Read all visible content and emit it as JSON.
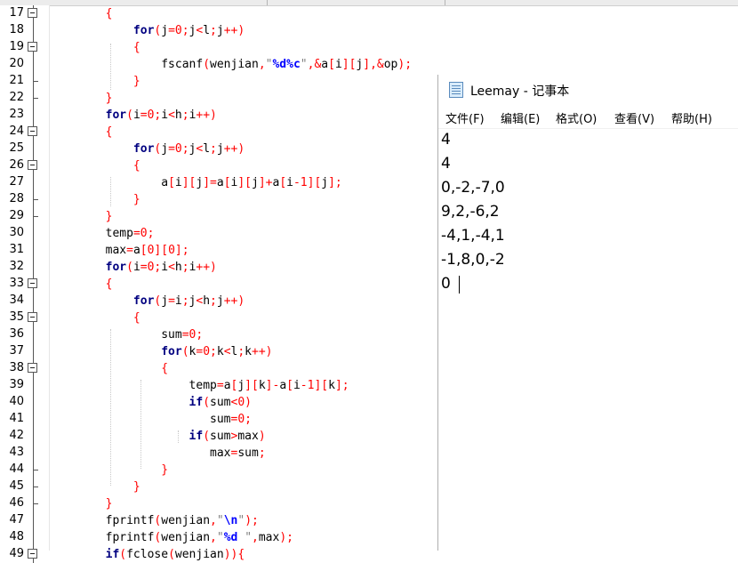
{
  "editor": {
    "lines": [
      {
        "n": "17",
        "fold": "box",
        "tokens": [
          {
            "t": "        {",
            "c": "op"
          }
        ]
      },
      {
        "n": "18",
        "fold": "line",
        "tokens": [
          {
            "t": "            ",
            "c": "id"
          },
          {
            "t": "for",
            "c": "kw"
          },
          {
            "t": "(",
            "c": "op"
          },
          {
            "t": "j",
            "c": "id"
          },
          {
            "t": "=",
            "c": "op"
          },
          {
            "t": "0",
            "c": "num"
          },
          {
            "t": ";",
            "c": "op"
          },
          {
            "t": "j",
            "c": "id"
          },
          {
            "t": "<",
            "c": "op"
          },
          {
            "t": "l",
            "c": "id"
          },
          {
            "t": ";",
            "c": "op"
          },
          {
            "t": "j",
            "c": "id"
          },
          {
            "t": "++)",
            "c": "op"
          }
        ]
      },
      {
        "n": "19",
        "fold": "box",
        "tokens": [
          {
            "t": "            {",
            "c": "op"
          }
        ]
      },
      {
        "n": "20",
        "fold": "line",
        "tokens": [
          {
            "t": "                ",
            "c": "id"
          },
          {
            "t": "fscanf",
            "c": "id"
          },
          {
            "t": "(",
            "c": "op"
          },
          {
            "t": "wenjian",
            "c": "id"
          },
          {
            "t": ",",
            "c": "op"
          },
          {
            "t": "\"",
            "c": "str"
          },
          {
            "t": "%d%c",
            "c": "fs"
          },
          {
            "t": "\"",
            "c": "str"
          },
          {
            "t": ",&",
            "c": "op"
          },
          {
            "t": "a",
            "c": "id"
          },
          {
            "t": "[",
            "c": "op"
          },
          {
            "t": "i",
            "c": "id"
          },
          {
            "t": "][",
            "c": "op"
          },
          {
            "t": "j",
            "c": "id"
          },
          {
            "t": "],&",
            "c": "op"
          },
          {
            "t": "op",
            "c": "id"
          },
          {
            "t": ");",
            "c": "op"
          }
        ]
      },
      {
        "n": "21",
        "fold": "tick",
        "tokens": [
          {
            "t": "            }",
            "c": "op"
          }
        ]
      },
      {
        "n": "22",
        "fold": "tick",
        "tokens": [
          {
            "t": "        }",
            "c": "op"
          }
        ]
      },
      {
        "n": "23",
        "fold": "line",
        "tokens": [
          {
            "t": "        ",
            "c": "id"
          },
          {
            "t": "for",
            "c": "kw"
          },
          {
            "t": "(",
            "c": "op"
          },
          {
            "t": "i",
            "c": "id"
          },
          {
            "t": "=",
            "c": "op"
          },
          {
            "t": "0",
            "c": "num"
          },
          {
            "t": ";",
            "c": "op"
          },
          {
            "t": "i",
            "c": "id"
          },
          {
            "t": "<",
            "c": "op"
          },
          {
            "t": "h",
            "c": "id"
          },
          {
            "t": ";",
            "c": "op"
          },
          {
            "t": "i",
            "c": "id"
          },
          {
            "t": "++)",
            "c": "op"
          }
        ]
      },
      {
        "n": "24",
        "fold": "box",
        "tokens": [
          {
            "t": "        {",
            "c": "op"
          }
        ]
      },
      {
        "n": "25",
        "fold": "line",
        "tokens": [
          {
            "t": "            ",
            "c": "id"
          },
          {
            "t": "for",
            "c": "kw"
          },
          {
            "t": "(",
            "c": "op"
          },
          {
            "t": "j",
            "c": "id"
          },
          {
            "t": "=",
            "c": "op"
          },
          {
            "t": "0",
            "c": "num"
          },
          {
            "t": ";",
            "c": "op"
          },
          {
            "t": "j",
            "c": "id"
          },
          {
            "t": "<",
            "c": "op"
          },
          {
            "t": "l",
            "c": "id"
          },
          {
            "t": ";",
            "c": "op"
          },
          {
            "t": "j",
            "c": "id"
          },
          {
            "t": "++)",
            "c": "op"
          }
        ]
      },
      {
        "n": "26",
        "fold": "box",
        "tokens": [
          {
            "t": "            {",
            "c": "op"
          }
        ]
      },
      {
        "n": "27",
        "fold": "line",
        "tokens": [
          {
            "t": "                ",
            "c": "id"
          },
          {
            "t": "a",
            "c": "id"
          },
          {
            "t": "[",
            "c": "op"
          },
          {
            "t": "i",
            "c": "id"
          },
          {
            "t": "][",
            "c": "op"
          },
          {
            "t": "j",
            "c": "id"
          },
          {
            "t": "]=",
            "c": "op"
          },
          {
            "t": "a",
            "c": "id"
          },
          {
            "t": "[",
            "c": "op"
          },
          {
            "t": "i",
            "c": "id"
          },
          {
            "t": "][",
            "c": "op"
          },
          {
            "t": "j",
            "c": "id"
          },
          {
            "t": "]+",
            "c": "op"
          },
          {
            "t": "a",
            "c": "id"
          },
          {
            "t": "[",
            "c": "op"
          },
          {
            "t": "i",
            "c": "id"
          },
          {
            "t": "-",
            "c": "op"
          },
          {
            "t": "1",
            "c": "num"
          },
          {
            "t": "][",
            "c": "op"
          },
          {
            "t": "j",
            "c": "id"
          },
          {
            "t": "];",
            "c": "op"
          }
        ]
      },
      {
        "n": "28",
        "fold": "tick",
        "tokens": [
          {
            "t": "            }",
            "c": "op"
          }
        ]
      },
      {
        "n": "29",
        "fold": "tick",
        "tokens": [
          {
            "t": "        }",
            "c": "op"
          }
        ]
      },
      {
        "n": "30",
        "fold": "line",
        "tokens": [
          {
            "t": "        ",
            "c": "id"
          },
          {
            "t": "temp",
            "c": "id"
          },
          {
            "t": "=",
            "c": "op"
          },
          {
            "t": "0",
            "c": "num"
          },
          {
            "t": ";",
            "c": "op"
          }
        ]
      },
      {
        "n": "31",
        "fold": "line",
        "tokens": [
          {
            "t": "        ",
            "c": "id"
          },
          {
            "t": "max",
            "c": "id"
          },
          {
            "t": "=",
            "c": "op"
          },
          {
            "t": "a",
            "c": "id"
          },
          {
            "t": "[",
            "c": "op"
          },
          {
            "t": "0",
            "c": "num"
          },
          {
            "t": "][",
            "c": "op"
          },
          {
            "t": "0",
            "c": "num"
          },
          {
            "t": "];",
            "c": "op"
          }
        ]
      },
      {
        "n": "32",
        "fold": "line",
        "tokens": [
          {
            "t": "        ",
            "c": "id"
          },
          {
            "t": "for",
            "c": "kw"
          },
          {
            "t": "(",
            "c": "op"
          },
          {
            "t": "i",
            "c": "id"
          },
          {
            "t": "=",
            "c": "op"
          },
          {
            "t": "0",
            "c": "num"
          },
          {
            "t": ";",
            "c": "op"
          },
          {
            "t": "i",
            "c": "id"
          },
          {
            "t": "<",
            "c": "op"
          },
          {
            "t": "h",
            "c": "id"
          },
          {
            "t": ";",
            "c": "op"
          },
          {
            "t": "i",
            "c": "id"
          },
          {
            "t": "++)",
            "c": "op"
          }
        ]
      },
      {
        "n": "33",
        "fold": "box",
        "tokens": [
          {
            "t": "        {",
            "c": "op"
          }
        ]
      },
      {
        "n": "34",
        "fold": "line",
        "tokens": [
          {
            "t": "            ",
            "c": "id"
          },
          {
            "t": "for",
            "c": "kw"
          },
          {
            "t": "(",
            "c": "op"
          },
          {
            "t": "j",
            "c": "id"
          },
          {
            "t": "=",
            "c": "op"
          },
          {
            "t": "i",
            "c": "id"
          },
          {
            "t": ";",
            "c": "op"
          },
          {
            "t": "j",
            "c": "id"
          },
          {
            "t": "<",
            "c": "op"
          },
          {
            "t": "h",
            "c": "id"
          },
          {
            "t": ";",
            "c": "op"
          },
          {
            "t": "j",
            "c": "id"
          },
          {
            "t": "++)",
            "c": "op"
          }
        ]
      },
      {
        "n": "35",
        "fold": "box",
        "tokens": [
          {
            "t": "            {",
            "c": "op"
          }
        ]
      },
      {
        "n": "36",
        "fold": "line",
        "tokens": [
          {
            "t": "                ",
            "c": "id"
          },
          {
            "t": "sum",
            "c": "id"
          },
          {
            "t": "=",
            "c": "op"
          },
          {
            "t": "0",
            "c": "num"
          },
          {
            "t": ";",
            "c": "op"
          }
        ]
      },
      {
        "n": "37",
        "fold": "line",
        "tokens": [
          {
            "t": "                ",
            "c": "id"
          },
          {
            "t": "for",
            "c": "kw"
          },
          {
            "t": "(",
            "c": "op"
          },
          {
            "t": "k",
            "c": "id"
          },
          {
            "t": "=",
            "c": "op"
          },
          {
            "t": "0",
            "c": "num"
          },
          {
            "t": ";",
            "c": "op"
          },
          {
            "t": "k",
            "c": "id"
          },
          {
            "t": "<",
            "c": "op"
          },
          {
            "t": "l",
            "c": "id"
          },
          {
            "t": ";",
            "c": "op"
          },
          {
            "t": "k",
            "c": "id"
          },
          {
            "t": "++)",
            "c": "op"
          }
        ]
      },
      {
        "n": "38",
        "fold": "box",
        "tokens": [
          {
            "t": "                {",
            "c": "op"
          }
        ]
      },
      {
        "n": "39",
        "fold": "line",
        "tokens": [
          {
            "t": "                    ",
            "c": "id"
          },
          {
            "t": "temp",
            "c": "id"
          },
          {
            "t": "=",
            "c": "op"
          },
          {
            "t": "a",
            "c": "id"
          },
          {
            "t": "[",
            "c": "op"
          },
          {
            "t": "j",
            "c": "id"
          },
          {
            "t": "][",
            "c": "op"
          },
          {
            "t": "k",
            "c": "id"
          },
          {
            "t": "]-",
            "c": "op"
          },
          {
            "t": "a",
            "c": "id"
          },
          {
            "t": "[",
            "c": "op"
          },
          {
            "t": "i",
            "c": "id"
          },
          {
            "t": "-",
            "c": "op"
          },
          {
            "t": "1",
            "c": "num"
          },
          {
            "t": "][",
            "c": "op"
          },
          {
            "t": "k",
            "c": "id"
          },
          {
            "t": "];",
            "c": "op"
          }
        ]
      },
      {
        "n": "40",
        "fold": "line",
        "tokens": [
          {
            "t": "                    ",
            "c": "id"
          },
          {
            "t": "if",
            "c": "kw"
          },
          {
            "t": "(",
            "c": "op"
          },
          {
            "t": "sum",
            "c": "id"
          },
          {
            "t": "<",
            "c": "op"
          },
          {
            "t": "0",
            "c": "num"
          },
          {
            "t": ")",
            "c": "op"
          }
        ]
      },
      {
        "n": "41",
        "fold": "line",
        "tokens": [
          {
            "t": "                       ",
            "c": "id"
          },
          {
            "t": "sum",
            "c": "id"
          },
          {
            "t": "=",
            "c": "op"
          },
          {
            "t": "0",
            "c": "num"
          },
          {
            "t": ";",
            "c": "op"
          }
        ]
      },
      {
        "n": "42",
        "fold": "line",
        "tokens": [
          {
            "t": "                    ",
            "c": "id"
          },
          {
            "t": "if",
            "c": "kw"
          },
          {
            "t": "(",
            "c": "op"
          },
          {
            "t": "sum",
            "c": "id"
          },
          {
            "t": ">",
            "c": "op"
          },
          {
            "t": "max",
            "c": "id"
          },
          {
            "t": ")",
            "c": "op"
          }
        ]
      },
      {
        "n": "43",
        "fold": "line",
        "tokens": [
          {
            "t": "                       ",
            "c": "id"
          },
          {
            "t": "max",
            "c": "id"
          },
          {
            "t": "=",
            "c": "op"
          },
          {
            "t": "sum",
            "c": "id"
          },
          {
            "t": ";",
            "c": "op"
          }
        ]
      },
      {
        "n": "44",
        "fold": "tick",
        "tokens": [
          {
            "t": "                }",
            "c": "op"
          }
        ]
      },
      {
        "n": "45",
        "fold": "tick",
        "tokens": [
          {
            "t": "            }",
            "c": "op"
          }
        ]
      },
      {
        "n": "46",
        "fold": "tick",
        "tokens": [
          {
            "t": "        }",
            "c": "op"
          }
        ]
      },
      {
        "n": "47",
        "fold": "line",
        "tokens": [
          {
            "t": "        ",
            "c": "id"
          },
          {
            "t": "fprintf",
            "c": "id"
          },
          {
            "t": "(",
            "c": "op"
          },
          {
            "t": "wenjian",
            "c": "id"
          },
          {
            "t": ",",
            "c": "op"
          },
          {
            "t": "\"",
            "c": "str"
          },
          {
            "t": "\\n",
            "c": "fs"
          },
          {
            "t": "\"",
            "c": "str"
          },
          {
            "t": ");",
            "c": "op"
          }
        ]
      },
      {
        "n": "48",
        "fold": "line",
        "tokens": [
          {
            "t": "        ",
            "c": "id"
          },
          {
            "t": "fprintf",
            "c": "id"
          },
          {
            "t": "(",
            "c": "op"
          },
          {
            "t": "wenjian",
            "c": "id"
          },
          {
            "t": ",",
            "c": "op"
          },
          {
            "t": "\"",
            "c": "str"
          },
          {
            "t": "%d ",
            "c": "fs"
          },
          {
            "t": "\"",
            "c": "str"
          },
          {
            "t": ",",
            "c": "op"
          },
          {
            "t": "max",
            "c": "id"
          },
          {
            "t": ");",
            "c": "op"
          }
        ]
      },
      {
        "n": "49",
        "fold": "box",
        "tokens": [
          {
            "t": "        ",
            "c": "id"
          },
          {
            "t": "if",
            "c": "kw"
          },
          {
            "t": "(",
            "c": "op"
          },
          {
            "t": "fclose",
            "c": "id"
          },
          {
            "t": "(",
            "c": "op"
          },
          {
            "t": "wenjian",
            "c": "id"
          },
          {
            "t": ")){",
            "c": "op"
          }
        ]
      }
    ]
  },
  "notepad": {
    "title": "Leemay - 记事本",
    "menu": [
      "文件(F)",
      "编辑(E)",
      "格式(O)",
      "查看(V)",
      "帮助(H)"
    ],
    "content": [
      "4",
      "4",
      "0,-2,-7,0",
      "9,2,-6,2",
      "-4,1,-4,1",
      "-1,8,0,-2",
      "0"
    ]
  }
}
